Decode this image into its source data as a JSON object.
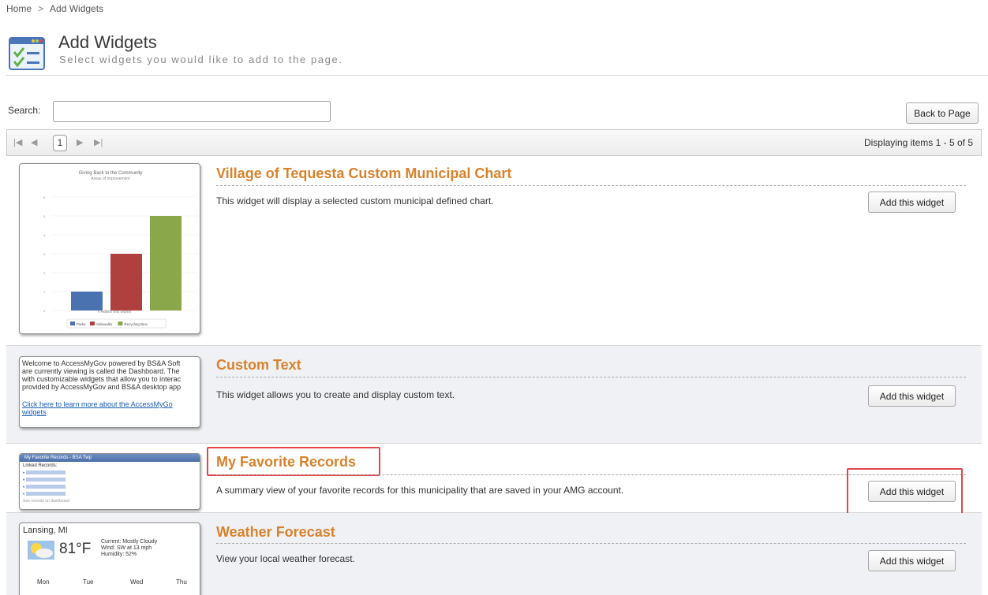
{
  "breadcrumb": {
    "home": "Home",
    "separator": ">",
    "current": "Add Widgets"
  },
  "header": {
    "title": "Add Widgets",
    "subtitle": "Select widgets you would like to add to the page.",
    "icon": "widgets-checklist-icon"
  },
  "search": {
    "label": "Search:",
    "value": "",
    "placeholder": ""
  },
  "back_button": "Back to Page",
  "pager": {
    "first": "⏮",
    "prev": "◀",
    "current_page": "1",
    "next": "▶",
    "last": "⏭",
    "info": "Displaying items 1 - 5 of 5"
  },
  "widgets": [
    {
      "title": "Village of Tequesta Custom Municipal Chart",
      "description": "This widget will display a selected custom municipal defined chart.",
      "button": "Add this widget",
      "thumbnail": {
        "chart_title": "Giving Back to the Community",
        "chart_subtitle": "Areas of Improvement",
        "x_label": "# Added this Month",
        "y_ticks": [
          "0",
          "1",
          "2",
          "3",
          "4",
          "5",
          "6"
        ],
        "bars": [
          {
            "name": "Parks",
            "value": 1,
            "color": "#4a72b0"
          },
          {
            "name": "Sidewalks",
            "value": 3,
            "color": "#b0403e"
          },
          {
            "name": "Recycling Bins",
            "value": 5,
            "color": "#8aa84a"
          }
        ],
        "legend": [
          "Parks",
          "Sidewalks",
          "Recycling Bins"
        ]
      }
    },
    {
      "title": "Custom Text",
      "description": "This widget allows you to create and display custom text.",
      "button": "Add this widget",
      "thumbnail": {
        "lines": [
          "Welcome to AccessMyGov powered by BS&A Soft",
          "are currently viewing is called the Dashboard. The",
          "with customizable widgets that allow you to interac",
          "provided by AccessMyGov and BS&A desktop app"
        ],
        "link_lines": [
          "Click here to learn more about the AccessMyGo",
          "widgets"
        ]
      }
    },
    {
      "title": "My Favorite Records",
      "description": "A summary view of your favorite records for this municipality that are saved in your AMG account.",
      "button": "Add this widget",
      "highlighted": true,
      "thumbnail": {
        "header": "My Favorite Records - BSA Twp",
        "label": "Linked Records:",
        "items": [
          "• ",
          "• ",
          "• ",
          "• "
        ],
        "footer": "See records on dashboard"
      }
    },
    {
      "title": "Weather Forecast",
      "description": "View your local weather forecast.",
      "button": "Add this widget",
      "thumbnail": {
        "location": "Lansing, MI",
        "temp": "81°F",
        "current": "Current: Mostly Cloudy",
        "wind": "Wind: SW at 13 mph",
        "humidity": "Humidity: 52%",
        "days": [
          "Mon",
          "Tue",
          "Wed",
          "Thu"
        ]
      }
    }
  ],
  "colors": {
    "title_orange": "#d9822b",
    "highlight_red": "#e2474c",
    "alt_row": "#eff1f4"
  }
}
